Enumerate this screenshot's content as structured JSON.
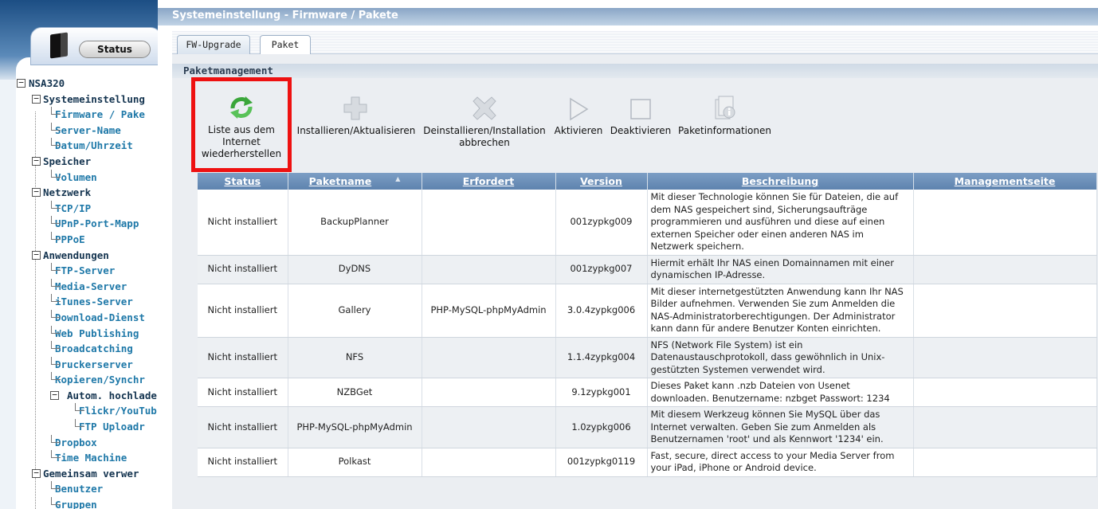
{
  "sidebar": {
    "status_label": "Status",
    "tree": [
      {
        "label": "NSA320",
        "level": 0,
        "expander": "−"
      },
      {
        "label": "Systemeinstellung",
        "level": 1,
        "expander": "−"
      },
      {
        "label": "Firmware / Pake",
        "level": 2
      },
      {
        "label": "Server-Name",
        "level": 2
      },
      {
        "label": "Datum/Uhrzeit",
        "level": 2
      },
      {
        "label": "Speicher",
        "level": 1,
        "expander": "−"
      },
      {
        "label": "Volumen",
        "level": 2
      },
      {
        "label": "Netzwerk",
        "level": 1,
        "expander": "−"
      },
      {
        "label": "TCP/IP",
        "level": 2
      },
      {
        "label": "UPnP-Port-Mapp",
        "level": 2
      },
      {
        "label": "PPPoE",
        "level": 2
      },
      {
        "label": "Anwendungen",
        "level": 1,
        "expander": "−"
      },
      {
        "label": "FTP-Server",
        "level": 2
      },
      {
        "label": "Media-Server",
        "level": 2
      },
      {
        "label": "iTunes-Server",
        "level": 2
      },
      {
        "label": "Download-Dienst",
        "level": 2
      },
      {
        "label": "Web Publishing",
        "level": 2
      },
      {
        "label": "Broadcatching",
        "level": 2
      },
      {
        "label": "Druckerserver",
        "level": 2
      },
      {
        "label": "Kopieren/Synchr",
        "level": 2
      },
      {
        "label": "Autom. hochlade",
        "level": 3,
        "expander": "−"
      },
      {
        "label": "Flickr/YouTub",
        "level": 4
      },
      {
        "label": "FTP Uploadr",
        "level": 4
      },
      {
        "label": "Dropbox",
        "level": 2
      },
      {
        "label": "Time Machine",
        "level": 2
      },
      {
        "label": "Gemeinsam verwer",
        "level": 1,
        "expander": "−"
      },
      {
        "label": "Benutzer",
        "level": 2
      },
      {
        "label": "Gruppen",
        "level": 2
      }
    ]
  },
  "header": {
    "title": "Systemeinstellung - Firmware / Pakete"
  },
  "tabs": [
    {
      "label": "FW-Upgrade"
    },
    {
      "label": "Paket"
    }
  ],
  "section_title": "Paketmanagement",
  "toolbar": {
    "refresh": {
      "label": "Liste aus dem Internet wiederherstellen",
      "icon": "refresh-icon"
    },
    "install": {
      "label": "Installieren/Aktualisieren",
      "icon": "plus-icon"
    },
    "uninstall": {
      "label": "Deinstallieren/Installation abbrechen",
      "icon": "cross-icon"
    },
    "activate": {
      "label": "Aktivieren",
      "icon": "play-icon"
    },
    "deactivate": {
      "label": "Deaktivieren",
      "icon": "stop-icon"
    },
    "info": {
      "label": "Paketinformationen",
      "icon": "info-icon"
    }
  },
  "table": {
    "columns": [
      "Status",
      "Paketname",
      "Erfordert",
      "Version",
      "Beschreibung",
      "Managementseite"
    ],
    "sort_indicator": "▲",
    "rows": [
      {
        "status": "Nicht installiert",
        "name": "BackupPlanner",
        "requires": "",
        "version": "001zypkg009",
        "description": "Mit dieser Technologie können Sie für Dateien, die auf dem NAS gespeichert sind, Sicherungsaufträge programmieren und ausführen und diese auf einen externen Speicher oder einen anderen NAS im Netzwerk speichern.",
        "management": ""
      },
      {
        "status": "Nicht installiert",
        "name": "DyDNS",
        "requires": "",
        "version": "001zypkg007",
        "description": "Hiermit erhält Ihr NAS einen Domainnamen mit einer dynamischen IP-Adresse.",
        "management": ""
      },
      {
        "status": "Nicht installiert",
        "name": "Gallery",
        "requires": "PHP-MySQL-phpMyAdmin",
        "version": "3.0.4zypkg006",
        "description": "Mit dieser internetgestützten Anwendung kann Ihr NAS Bilder aufnehmen. Verwenden Sie zum Anmelden die NAS-Administratorberechtigungen. Der Administrator kann dann für andere Benutzer Konten einrichten.",
        "management": ""
      },
      {
        "status": "Nicht installiert",
        "name": "NFS",
        "requires": "",
        "version": "1.1.4zypkg004",
        "description": "NFS (Network File System) ist ein Datenaustauschprotokoll, dass gewöhnlich in Unix-gestützten Systemen verwendet wird.",
        "management": ""
      },
      {
        "status": "Nicht installiert",
        "name": "NZBGet",
        "requires": "",
        "version": "9.1zypkg001",
        "description": "Dieses Paket kann .nzb Dateien von Usenet downloaden. Benutzername: nzbget Passwort: 1234",
        "management": ""
      },
      {
        "status": "Nicht installiert",
        "name": "PHP-MySQL-phpMyAdmin",
        "requires": "",
        "version": "1.0zypkg006",
        "description": "Mit diesem Werkzeug können Sie MySQL über das Internet verwalten. Geben Sie zum Anmelden als Benutzernamen 'root' und als Kennwort '1234' ein.",
        "management": ""
      },
      {
        "status": "Nicht installiert",
        "name": "Polkast",
        "requires": "",
        "version": "001zypkg0119",
        "description": "Fast, secure, direct access to your Media Server from your iPad, iPhone or Android device.",
        "management": ""
      }
    ]
  },
  "colors": {
    "highlight_box": "#ee1111",
    "table_header": "#6a8db6",
    "refresh_icon": "#3aa63a"
  }
}
